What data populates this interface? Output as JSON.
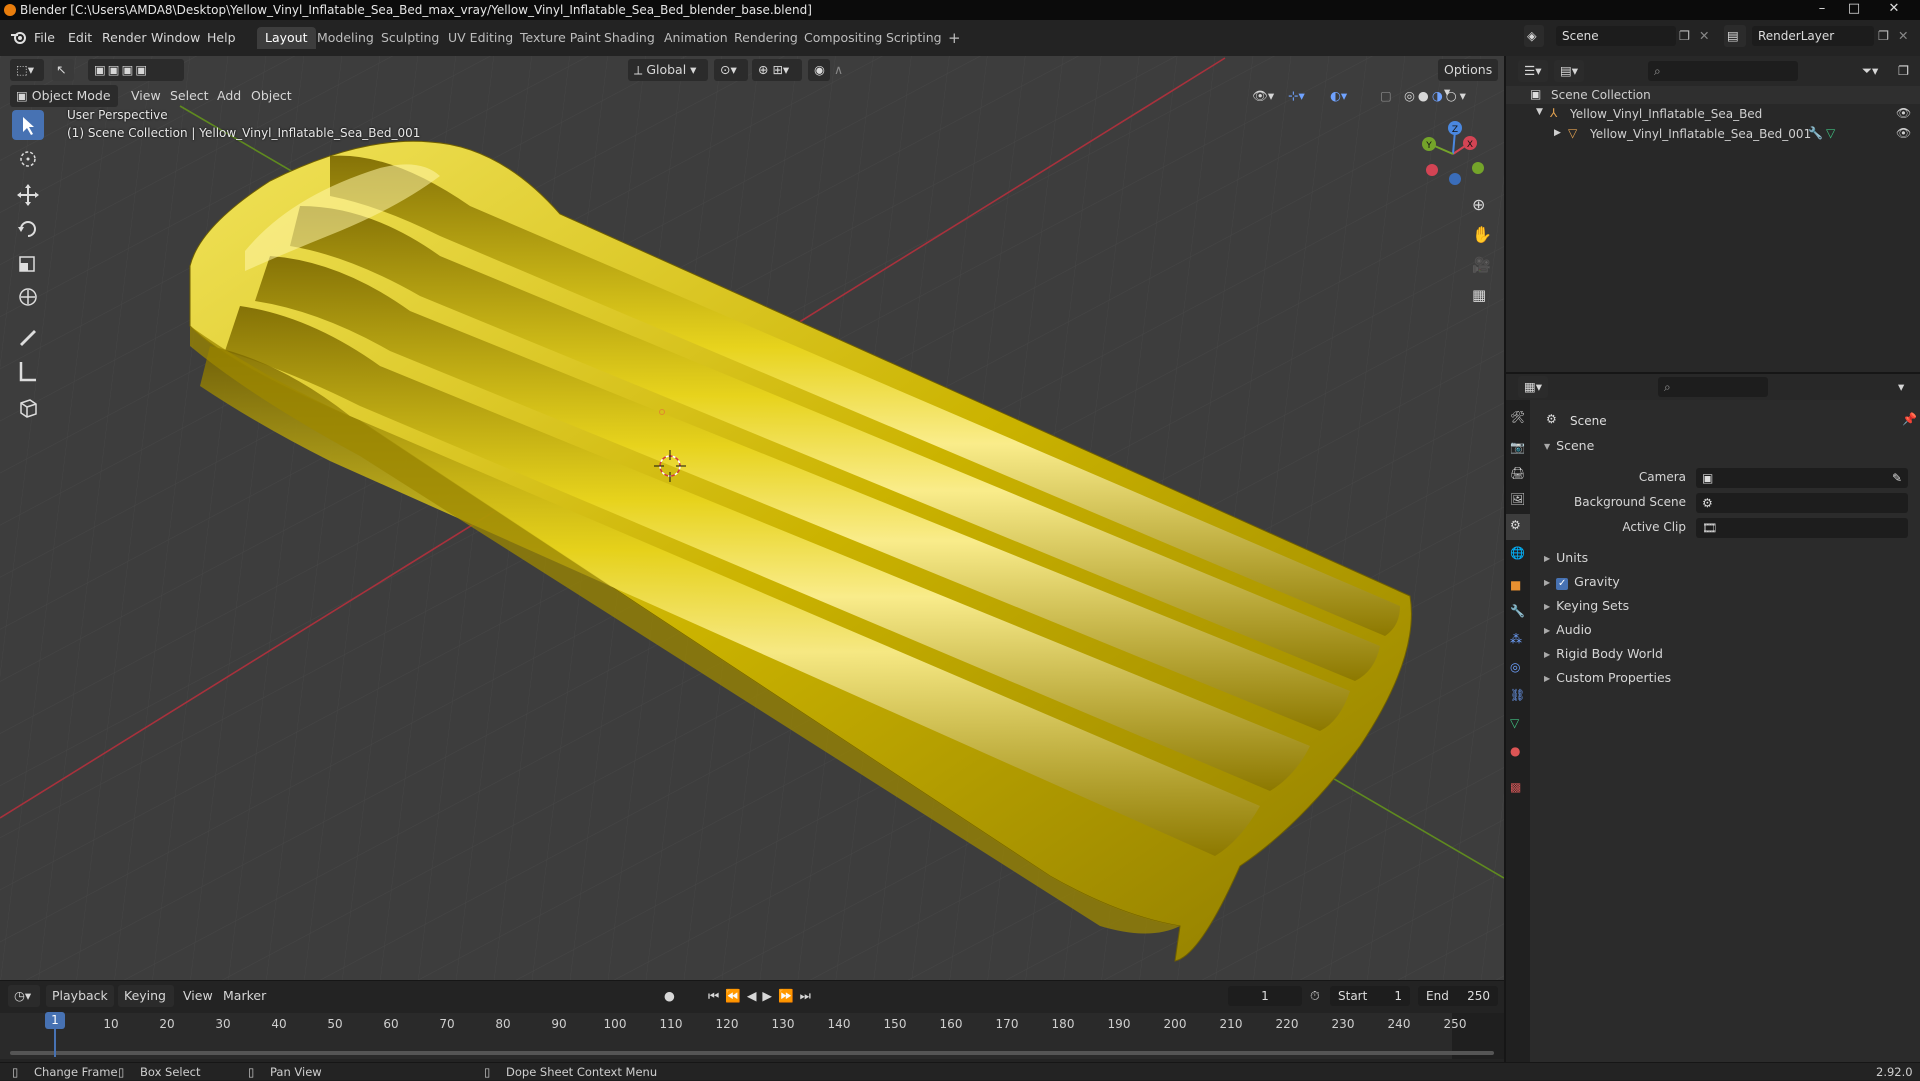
{
  "window": {
    "title": "Blender [C:\\Users\\AMDA8\\Desktop\\Yellow_Vinyl_Inflatable_Sea_Bed_max_vray/Yellow_Vinyl_Inflatable_Sea_Bed_blender_base.blend]",
    "minimize": "–",
    "maximize": "□",
    "close": "✕"
  },
  "menu": {
    "file": "File",
    "edit": "Edit",
    "render": "Render",
    "window": "Window",
    "help": "Help"
  },
  "workspaces": [
    "Layout",
    "Modeling",
    "Sculpting",
    "UV Editing",
    "Texture Paint",
    "Shading",
    "Animation",
    "Rendering",
    "Compositing",
    "Scripting"
  ],
  "workspace_add": "+",
  "scene": {
    "name": "Scene",
    "render_layer": "RenderLayer"
  },
  "viewport": {
    "mode": "Object Mode",
    "menus": {
      "view": "View",
      "select": "Select",
      "add": "Add",
      "object": "Object"
    },
    "orientation": "Global",
    "options": "Options",
    "perspective_label": "User Perspective",
    "collection_label": "(1) Scene Collection | Yellow_Vinyl_Inflatable_Sea_Bed_001",
    "gizmo": {
      "x": "X",
      "y": "Y",
      "z": "Z"
    }
  },
  "timeline": {
    "menus": {
      "playback": "Playback",
      "keying": "Keying",
      "view": "View",
      "marker": "Marker"
    },
    "current_frame": "1",
    "start_label": "Start",
    "start": "1",
    "end_label": "End",
    "end": "250",
    "ticks": [
      "10",
      "20",
      "30",
      "40",
      "50",
      "60",
      "70",
      "80",
      "90",
      "100",
      "110",
      "120",
      "130",
      "140",
      "150",
      "160",
      "170",
      "180",
      "190",
      "200",
      "210",
      "220",
      "230",
      "240",
      "250"
    ],
    "playhead": "1"
  },
  "status": {
    "change_frame": "Change Frame",
    "box_select": "Box Select",
    "pan_view": "Pan View",
    "context_menu": "Dope Sheet Context Menu",
    "version": "2.92.0"
  },
  "outliner": {
    "root": "Scene Collection",
    "collection": "Yellow_Vinyl_Inflatable_Sea_Bed",
    "object": "Yellow_Vinyl_Inflatable_Sea_Bed_001"
  },
  "properties": {
    "context": "Scene",
    "panel": "Scene",
    "camera_label": "Camera",
    "background_label": "Background Scene",
    "clip_label": "Active Clip",
    "sections": [
      "Units",
      "Gravity",
      "Keying Sets",
      "Audio",
      "Rigid Body World",
      "Custom Properties"
    ]
  },
  "colors": {
    "accent": "#4772b3",
    "viewport_bg": "#3d3d3d",
    "object_yellow": "#d8c400",
    "x_axis": "#c0303a",
    "y_axis": "#6a9a22"
  }
}
